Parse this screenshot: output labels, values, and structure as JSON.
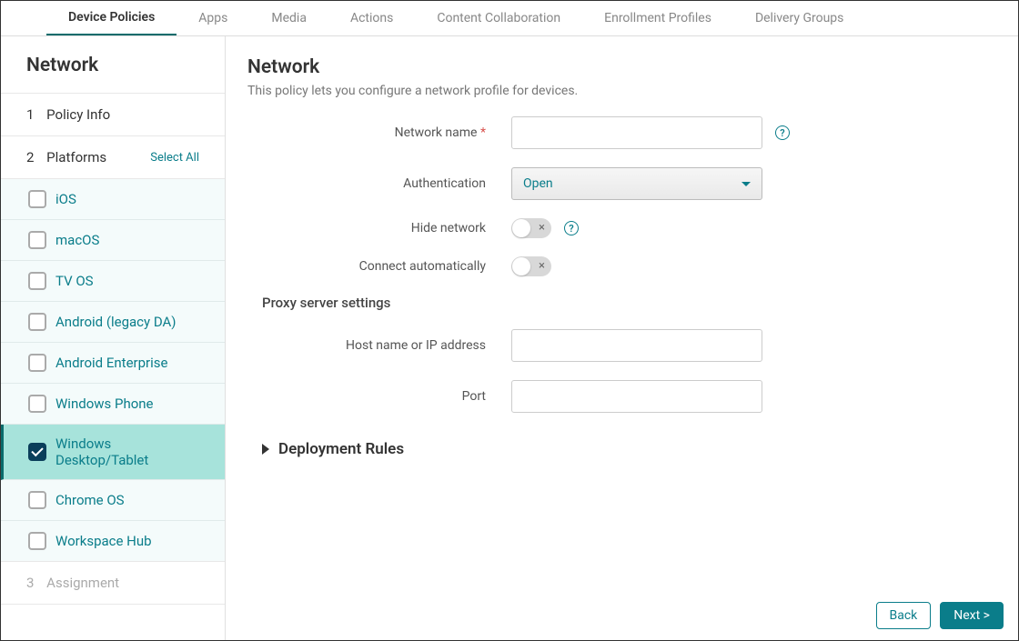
{
  "topnav": {
    "tabs": [
      "Device Policies",
      "Apps",
      "Media",
      "Actions",
      "Content Collaboration",
      "Enrollment Profiles",
      "Delivery Groups"
    ]
  },
  "sidebar": {
    "title": "Network",
    "steps": {
      "policy_info": {
        "num": "1",
        "label": "Policy Info"
      },
      "platforms": {
        "num": "2",
        "label": "Platforms",
        "select_all": "Select All"
      },
      "assignment": {
        "num": "3",
        "label": "Assignment"
      }
    },
    "platforms": [
      "iOS",
      "macOS",
      "TV OS",
      "Android (legacy DA)",
      "Android Enterprise",
      "Windows Phone",
      "Windows Desktop/Tablet",
      "Chrome OS",
      "Workspace Hub"
    ]
  },
  "main": {
    "heading": "Network",
    "subtitle": "This policy lets you configure a network profile for devices.",
    "labels": {
      "network_name": "Network name",
      "required": "*",
      "authentication": "Authentication",
      "hide_network": "Hide network",
      "connect_auto": "Connect automatically",
      "proxy_header": "Proxy server settings",
      "host": "Host name or IP address",
      "port": "Port",
      "deployment_rules": "Deployment Rules"
    },
    "values": {
      "authentication_selected": "Open",
      "toggle_off_mark": "×"
    },
    "help": "?"
  },
  "footer": {
    "back": "Back",
    "next": "Next >"
  }
}
